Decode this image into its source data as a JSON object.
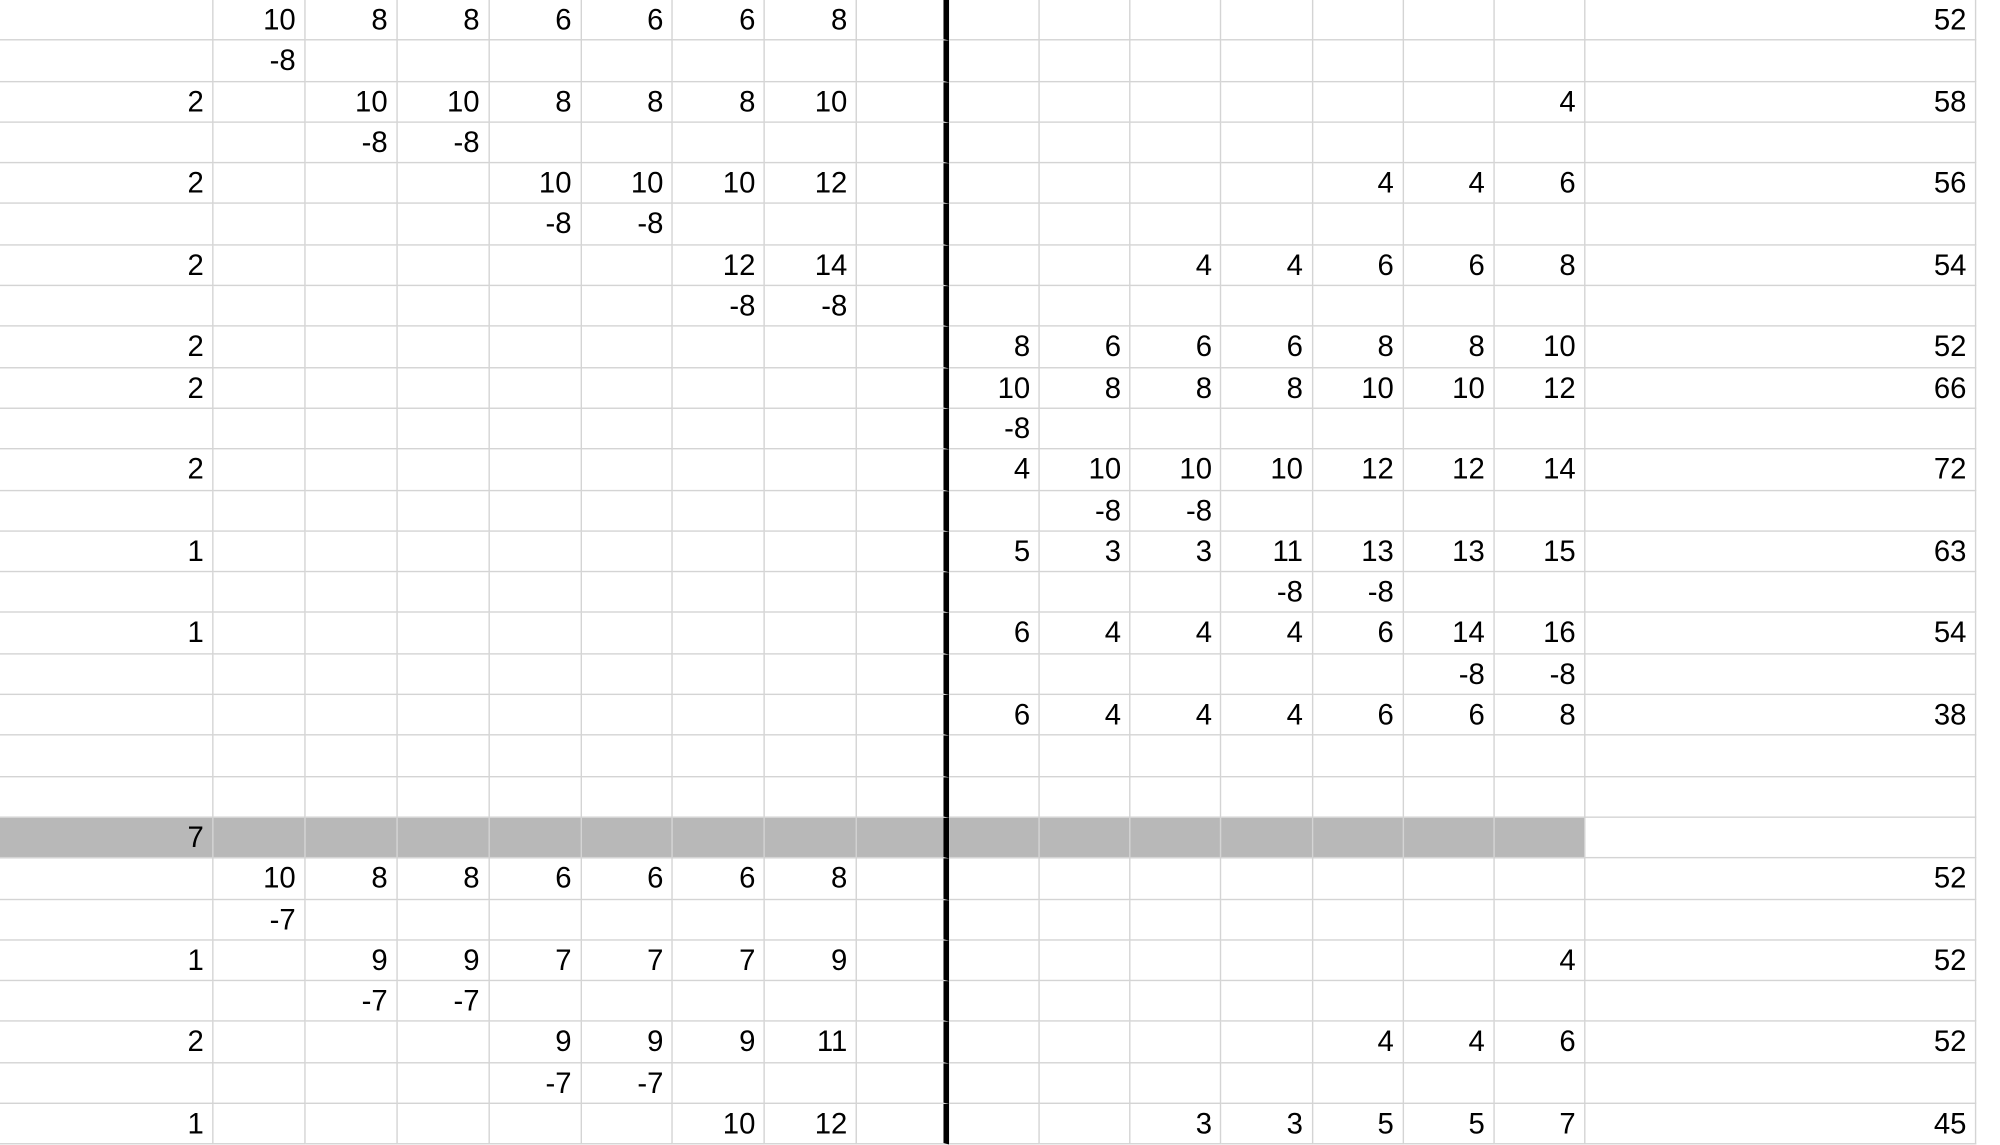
{
  "columns": 17,
  "thick_border_after_col": 9,
  "shaded_row_index": 20,
  "shaded_cols_end": 16,
  "rows": [
    [
      "",
      "10",
      "8",
      "8",
      "6",
      "6",
      "6",
      "8",
      "",
      "",
      "",
      "",
      "",
      "",
      "",
      "",
      "52"
    ],
    [
      "",
      "-8",
      "",
      "",
      "",
      "",
      "",
      "",
      "",
      "",
      "",
      "",
      "",
      "",
      "",
      "",
      ""
    ],
    [
      "2",
      "",
      "10",
      "10",
      "8",
      "8",
      "8",
      "10",
      "",
      "",
      "",
      "",
      "",
      "",
      "",
      "4",
      "58"
    ],
    [
      "",
      "",
      "-8",
      "-8",
      "",
      "",
      "",
      "",
      "",
      "",
      "",
      "",
      "",
      "",
      "",
      "",
      ""
    ],
    [
      "2",
      "",
      "",
      "",
      "10",
      "10",
      "10",
      "12",
      "",
      "",
      "",
      "",
      "",
      "4",
      "4",
      "6",
      "56"
    ],
    [
      "",
      "",
      "",
      "",
      "-8",
      "-8",
      "",
      "",
      "",
      "",
      "",
      "",
      "",
      "",
      "",
      "",
      ""
    ],
    [
      "2",
      "",
      "",
      "",
      "",
      "",
      "12",
      "14",
      "",
      "",
      "",
      "4",
      "4",
      "6",
      "6",
      "8",
      "54"
    ],
    [
      "",
      "",
      "",
      "",
      "",
      "",
      "-8",
      "-8",
      "",
      "",
      "",
      "",
      "",
      "",
      "",
      "",
      ""
    ],
    [
      "2",
      "",
      "",
      "",
      "",
      "",
      "",
      "",
      "",
      "8",
      "6",
      "6",
      "6",
      "8",
      "8",
      "10",
      "52"
    ],
    [
      "2",
      "",
      "",
      "",
      "",
      "",
      "",
      "",
      "",
      "10",
      "8",
      "8",
      "8",
      "10",
      "10",
      "12",
      "66"
    ],
    [
      "",
      "",
      "",
      "",
      "",
      "",
      "",
      "",
      "",
      "-8",
      "",
      "",
      "",
      "",
      "",
      "",
      ""
    ],
    [
      "2",
      "",
      "",
      "",
      "",
      "",
      "",
      "",
      "",
      "4",
      "10",
      "10",
      "10",
      "12",
      "12",
      "14",
      "72"
    ],
    [
      "",
      "",
      "",
      "",
      "",
      "",
      "",
      "",
      "",
      "",
      "-8",
      "-8",
      "",
      "",
      "",
      "",
      ""
    ],
    [
      "1",
      "",
      "",
      "",
      "",
      "",
      "",
      "",
      "",
      "5",
      "3",
      "3",
      "11",
      "13",
      "13",
      "15",
      "63"
    ],
    [
      "",
      "",
      "",
      "",
      "",
      "",
      "",
      "",
      "",
      "",
      "",
      "",
      "-8",
      "-8",
      "",
      "",
      ""
    ],
    [
      "1",
      "",
      "",
      "",
      "",
      "",
      "",
      "",
      "",
      "6",
      "4",
      "4",
      "4",
      "6",
      "14",
      "16",
      "54"
    ],
    [
      "",
      "",
      "",
      "",
      "",
      "",
      "",
      "",
      "",
      "",
      "",
      "",
      "",
      "",
      "-8",
      "-8",
      ""
    ],
    [
      "",
      "",
      "",
      "",
      "",
      "",
      "",
      "",
      "",
      "6",
      "4",
      "4",
      "4",
      "6",
      "6",
      "8",
      "38"
    ],
    [
      "",
      "",
      "",
      "",
      "",
      "",
      "",
      "",
      "",
      "",
      "",
      "",
      "",
      "",
      "",
      "",
      ""
    ],
    [
      "",
      "",
      "",
      "",
      "",
      "",
      "",
      "",
      "",
      "",
      "",
      "",
      "",
      "",
      "",
      "",
      ""
    ],
    [
      "7",
      "",
      "",
      "",
      "",
      "",
      "",
      "",
      "",
      "",
      "",
      "",
      "",
      "",
      "",
      "",
      ""
    ],
    [
      "",
      "10",
      "8",
      "8",
      "6",
      "6",
      "6",
      "8",
      "",
      "",
      "",
      "",
      "",
      "",
      "",
      "",
      "52"
    ],
    [
      "",
      "-7",
      "",
      "",
      "",
      "",
      "",
      "",
      "",
      "",
      "",
      "",
      "",
      "",
      "",
      "",
      ""
    ],
    [
      "1",
      "",
      "9",
      "9",
      "7",
      "7",
      "7",
      "9",
      "",
      "",
      "",
      "",
      "",
      "",
      "",
      "4",
      "52"
    ],
    [
      "",
      "",
      "-7",
      "-7",
      "",
      "",
      "",
      "",
      "",
      "",
      "",
      "",
      "",
      "",
      "",
      "",
      ""
    ],
    [
      "2",
      "",
      "",
      "",
      "9",
      "9",
      "9",
      "11",
      "",
      "",
      "",
      "",
      "",
      "4",
      "4",
      "6",
      "52"
    ],
    [
      "",
      "",
      "",
      "",
      "-7",
      "-7",
      "",
      "",
      "",
      "",
      "",
      "",
      "",
      "",
      "",
      "",
      ""
    ],
    [
      "1",
      "",
      "",
      "",
      "",
      "",
      "10",
      "12",
      "",
      "",
      "",
      "3",
      "3",
      "5",
      "5",
      "7",
      "45"
    ]
  ]
}
